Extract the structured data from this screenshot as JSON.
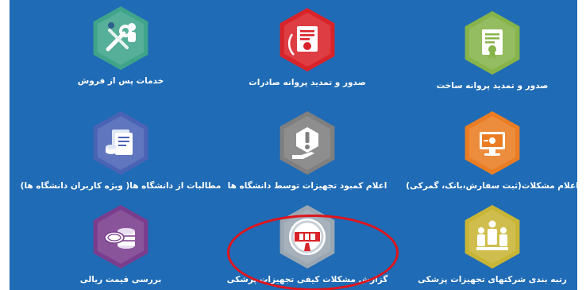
{
  "tiles": [
    {
      "id": "after-sales",
      "label": "خدمات پس از فروش",
      "icon": "tools-person-icon",
      "color": "#3fa48a"
    },
    {
      "id": "export-license",
      "label": "صدور و تمدید پروانه صادرات",
      "icon": "certificate-icon",
      "color": "#d9232a"
    },
    {
      "id": "manufacture-license",
      "label": "صدور و تمدید پروانه ساخت",
      "icon": "certificate-icon",
      "color": "#86b34a"
    },
    {
      "id": "university-claims",
      "label": "مطالبات از دانشگاه ها( ویژه کاربران دانشگاه ها)",
      "icon": "documents-icon",
      "color": "#4a63b5"
    },
    {
      "id": "equipment-shortage",
      "label": "اعلام کمبود تجهیزات توسط دانشگاه ها",
      "icon": "alert-hand-icon",
      "color": "#7f7f7f"
    },
    {
      "id": "problems-report",
      "label": "اعلام مشکلات(ثبت سفارش،بانک، گمرکی)",
      "icon": "monitor-icon",
      "color": "#ea7d23"
    },
    {
      "id": "rial-price-review",
      "label": "بررسی قیمت ریالی",
      "icon": "coins-icon",
      "color": "#7a3d8e"
    },
    {
      "id": "quality-report",
      "label": "گزارش مشکلات کیفی تجهیزات پزشکی",
      "icon": "mdr-logo-icon",
      "color": "#9aa7b3"
    },
    {
      "id": "company-ranking",
      "label": "رتبه بندی شرکتهای تجهیزات پزشکی",
      "icon": "people-ranking-icon",
      "color": "#c9b535"
    }
  ],
  "highlight_color": "#e0141b"
}
